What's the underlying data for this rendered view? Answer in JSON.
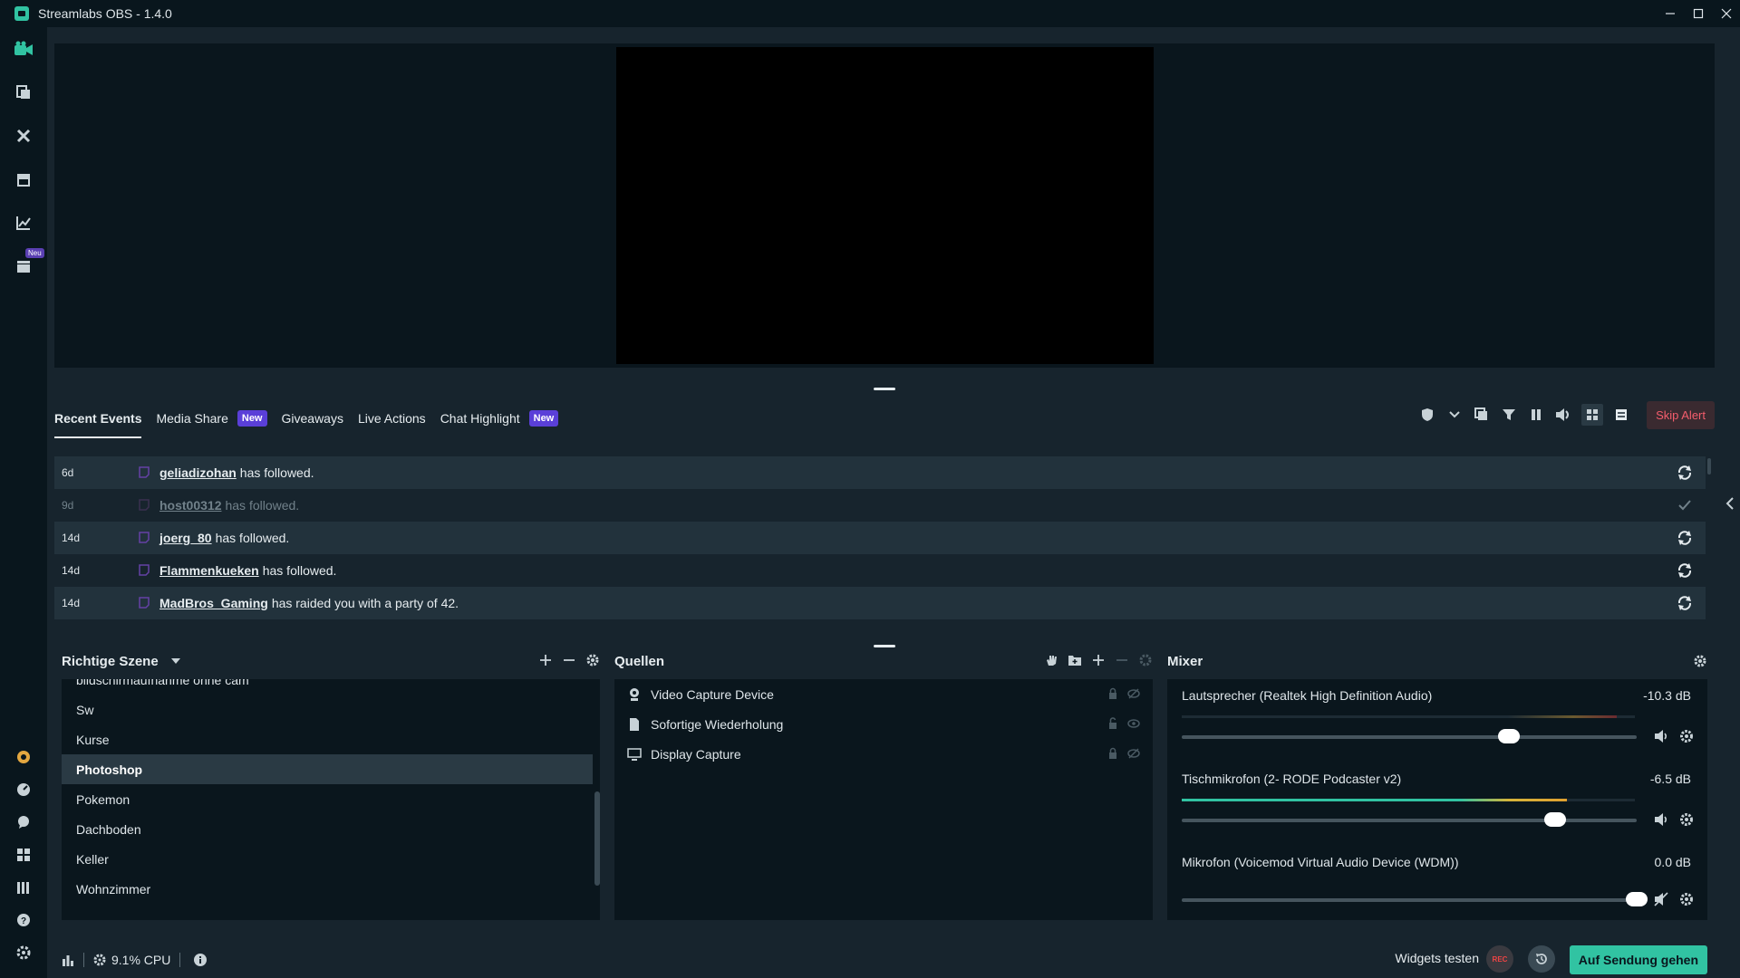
{
  "window": {
    "title": "Streamlabs OBS - 1.4.0"
  },
  "nav": {
    "badge": "Neu"
  },
  "events": {
    "tabs": [
      {
        "label": "Recent Events"
      },
      {
        "label": "Media Share",
        "badge": "New"
      },
      {
        "label": "Giveaways"
      },
      {
        "label": "Live Actions"
      },
      {
        "label": "Chat Highlight",
        "badge": "New"
      }
    ],
    "skip_alert": "Skip Alert",
    "rows": [
      {
        "time": "6d",
        "user": "geliadizohan",
        "text": "has followed."
      },
      {
        "time": "9d",
        "user": "host00312",
        "text": "has followed."
      },
      {
        "time": "14d",
        "user": "joerg_80",
        "text": "has followed."
      },
      {
        "time": "14d",
        "user": "Flammenkueken",
        "text": "has followed."
      },
      {
        "time": "14d",
        "user": "MadBros_Gaming",
        "text": "has raided you with a party of 42."
      }
    ]
  },
  "scenes": {
    "title": "Richtige Szene",
    "items": [
      "bildschirmaufnahme ohne cam",
      "Sw",
      "Kurse",
      "Photoshop",
      "Pokemon",
      "Dachboden",
      "Keller",
      "Wohnzimmer"
    ],
    "selected": "Photoshop"
  },
  "sources": {
    "title": "Quellen",
    "items": [
      "Video Capture Device",
      "Sofortige Wiederholung",
      "Display Capture"
    ]
  },
  "mixer": {
    "title": "Mixer",
    "items": [
      {
        "name": "Lautsprecher (Realtek High Definition Audio)",
        "db": "-10.3 dB",
        "level": 0.72
      },
      {
        "name": "Tischmikrofon (2- RODE Podcaster v2)",
        "db": "-6.5 dB",
        "level": 0.82
      },
      {
        "name": "Mikrofon (Voicemod Virtual Audio Device (WDM))",
        "db": "0.0 dB",
        "level": 1.0
      }
    ]
  },
  "footer": {
    "cpu": "9.1% CPU",
    "widgets": "Widgets testen",
    "rec": "REC",
    "go_live": "Auf Sendung gehen"
  },
  "colors": {
    "accent": "#31c3a2",
    "badge": "#5a3fd8",
    "skip": "#f45d6c"
  }
}
